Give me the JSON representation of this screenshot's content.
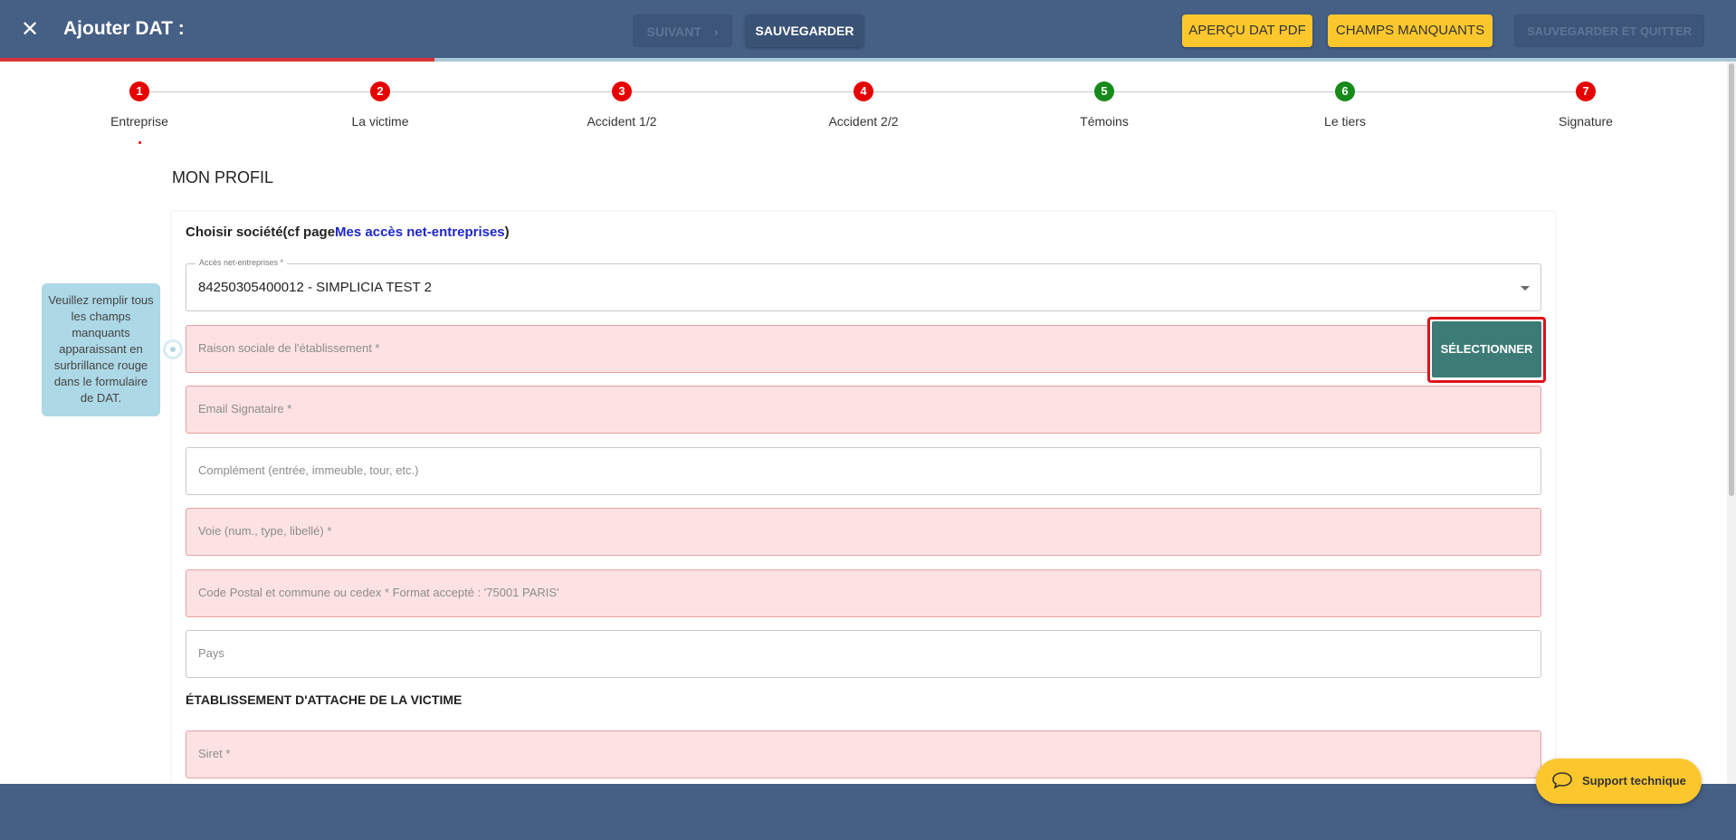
{
  "header": {
    "title": "Ajouter DAT :",
    "close_icon": "close-icon",
    "suivant_label": "SUIVANT",
    "sauvegarder_label": "SAUVEGARDER",
    "apercu_label": "APERÇU DAT PDF",
    "champs_label": "CHAMPS MANQUANTS",
    "sauvegarder_quitter_label": "SAUVEGARDER ET QUITTER",
    "progress": 0.25
  },
  "steps": [
    {
      "num": "1",
      "label": "Entreprise",
      "status": "red"
    },
    {
      "num": "2",
      "label": "La victime",
      "status": "red"
    },
    {
      "num": "3",
      "label": "Accident 1/2",
      "status": "red"
    },
    {
      "num": "4",
      "label": "Accident 2/2",
      "status": "red"
    },
    {
      "num": "5",
      "label": "Témoins",
      "status": "green"
    },
    {
      "num": "6",
      "label": "Le tiers",
      "status": "green"
    },
    {
      "num": "7",
      "label": "Signature",
      "status": "red"
    }
  ],
  "section_title": "MON PROFIL",
  "form": {
    "choisir_label": "Choisir société(cf page",
    "choisir_link": "Mes accès net-entreprises",
    "choisir_close": ")",
    "acces_label": "Accès net-entreprises *",
    "acces_value": "84250305400012 - SIMPLICIA TEST 2",
    "raison_placeholder": "Raison sociale de l'établissement *",
    "selectionner_label": "SÉLECTIONNER",
    "email_placeholder": "Email Signataire *",
    "complement_placeholder": "Complément (entrée, immeuble, tour, etc.)",
    "voie_placeholder": "Voie (num., type, libellé) *",
    "cp_placeholder": "Code Postal et commune ou cedex * Format accepté : '75001 PARIS'",
    "pays_placeholder": "Pays",
    "etab_title": "ÉTABLISSEMENT D'ATTACHE DE LA VICTIME",
    "siret_placeholder": "Siret *"
  },
  "tooltip": {
    "text": "Veuillez remplir tous les champs manquants apparaissant en surbrillance rouge dans le formulaire de DAT."
  },
  "support": {
    "label": "Support technique",
    "icon": "chat-bubble-icon"
  },
  "colors": {
    "header_bg": "#465f85",
    "accent_yellow": "#fcc72d",
    "error_bg": "#fde2e3",
    "step_red": "#e60000",
    "step_green": "#168a1a",
    "select_button": "#3d7c76"
  }
}
